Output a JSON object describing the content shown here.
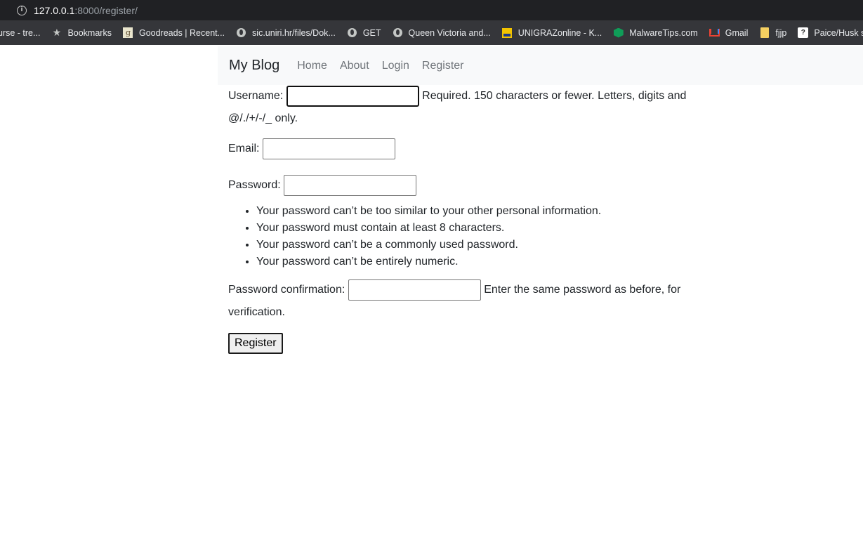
{
  "browser": {
    "url_host": "127.0.0.1",
    "url_path": ":8000/register/",
    "bookmarks": [
      {
        "label": "urse - tre...",
        "icon": "none"
      },
      {
        "label": "Bookmarks",
        "icon": "star-icon"
      },
      {
        "label": "Goodreads | Recent...",
        "icon": "goodreads-icon"
      },
      {
        "label": "sic.uniri.hr/files/Dok...",
        "icon": "globe-icon"
      },
      {
        "label": "GET",
        "icon": "globe-icon"
      },
      {
        "label": "Queen Victoria and...",
        "icon": "globe-icon"
      },
      {
        "label": "UNIGRAZonline - K...",
        "icon": "unigraz-icon"
      },
      {
        "label": "MalwareTips.com",
        "icon": "malwaretips-icon"
      },
      {
        "label": "Gmail",
        "icon": "gmail-icon"
      },
      {
        "label": "fjjp",
        "icon": "folder-icon"
      },
      {
        "label": "Paice/Husk stemme",
        "icon": "placeholder-icon"
      }
    ]
  },
  "navbar": {
    "brand": "My Blog",
    "links": [
      "Home",
      "About",
      "Login",
      "Register"
    ]
  },
  "form": {
    "username_label": "Username:",
    "username_help": "Required. 150 characters or fewer. Letters, digits and @/./+/-/_ only.",
    "email_label": "Email:",
    "password_label": "Password:",
    "password_rules": [
      "Your password can’t be too similar to your other personal information.",
      "Your password must contain at least 8 characters.",
      "Your password can’t be a commonly used password.",
      "Your password can’t be entirely numeric."
    ],
    "password_confirm_label": "Password confirmation:",
    "password_confirm_help": "Enter the same password as before, for verification.",
    "submit_label": "Register"
  },
  "colors": {
    "chrome_dark": "#202124",
    "bookmarks_bar": "#35363a",
    "navbar_bg": "#f8f9fa",
    "nav_link": "#6f7479"
  }
}
